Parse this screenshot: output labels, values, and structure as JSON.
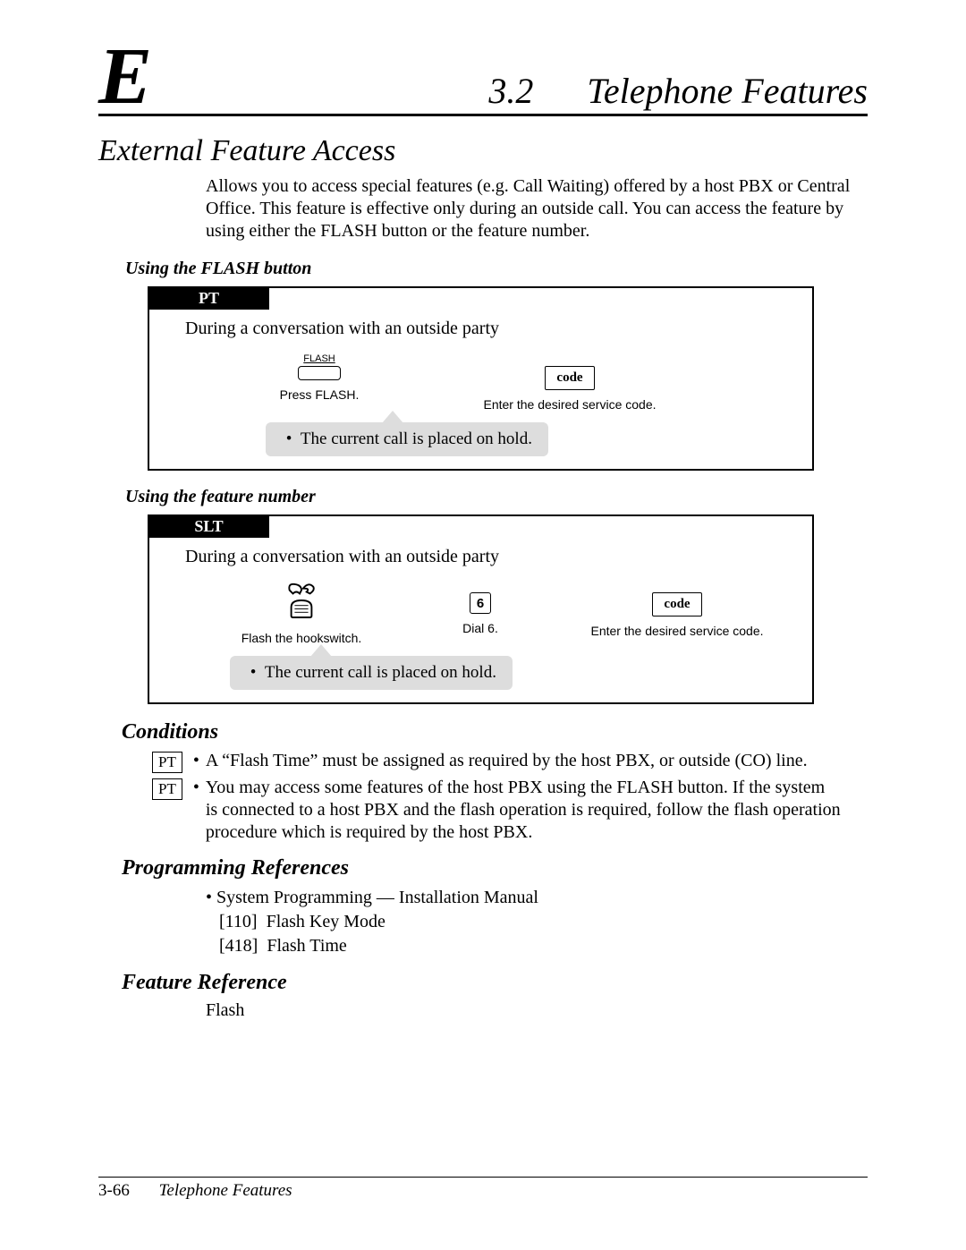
{
  "header": {
    "index_letter": "E",
    "section_number": "3.2",
    "section_title": "Telephone Features"
  },
  "feature_title": "External Feature Access",
  "intro_text": "Allows you to access special features (e.g. Call Waiting) offered by a host PBX or Central Office. This feature is effective only during an outside call. You can access the feature by using either the FLASH button or the feature number.",
  "proc1": {
    "subhead": "Using the FLASH button",
    "tab": "PT",
    "during": "During a conversation with an outside party",
    "flash_top": "FLASH",
    "flash_caption": "Press FLASH.",
    "code_label": "code",
    "code_caption": "Enter the desired service code.",
    "note": "The current call is placed on hold."
  },
  "proc2": {
    "subhead": "Using the feature number",
    "tab": "SLT",
    "during": "During a conversation with an outside party",
    "hook_caption": "Flash the hookswitch.",
    "dial_digit": "6",
    "dial_caption": "Dial 6.",
    "code_label": "code",
    "code_caption": "Enter the desired service code.",
    "note": "The current call is placed on hold."
  },
  "conditions": {
    "heading": "Conditions",
    "item1_tag": "PT",
    "item1_text": "A “Flash Time” must be assigned as required by the host PBX, or outside (CO) line.",
    "item2_tag": "PT",
    "item2_text": "You may access some features of the host PBX using the FLASH button. If the system is connected to a host PBX and the flash operation is required, follow the flash operation procedure which is required by the host PBX."
  },
  "programming": {
    "heading": "Programming References",
    "line1": "System Programming — Installation Manual",
    "line2": "[110]  Flash Key Mode",
    "line3": "[418]  Flash Time"
  },
  "feature_ref": {
    "heading": "Feature Reference",
    "line1": "Flash"
  },
  "footer": {
    "page": "3-66",
    "title": "Telephone Features"
  }
}
